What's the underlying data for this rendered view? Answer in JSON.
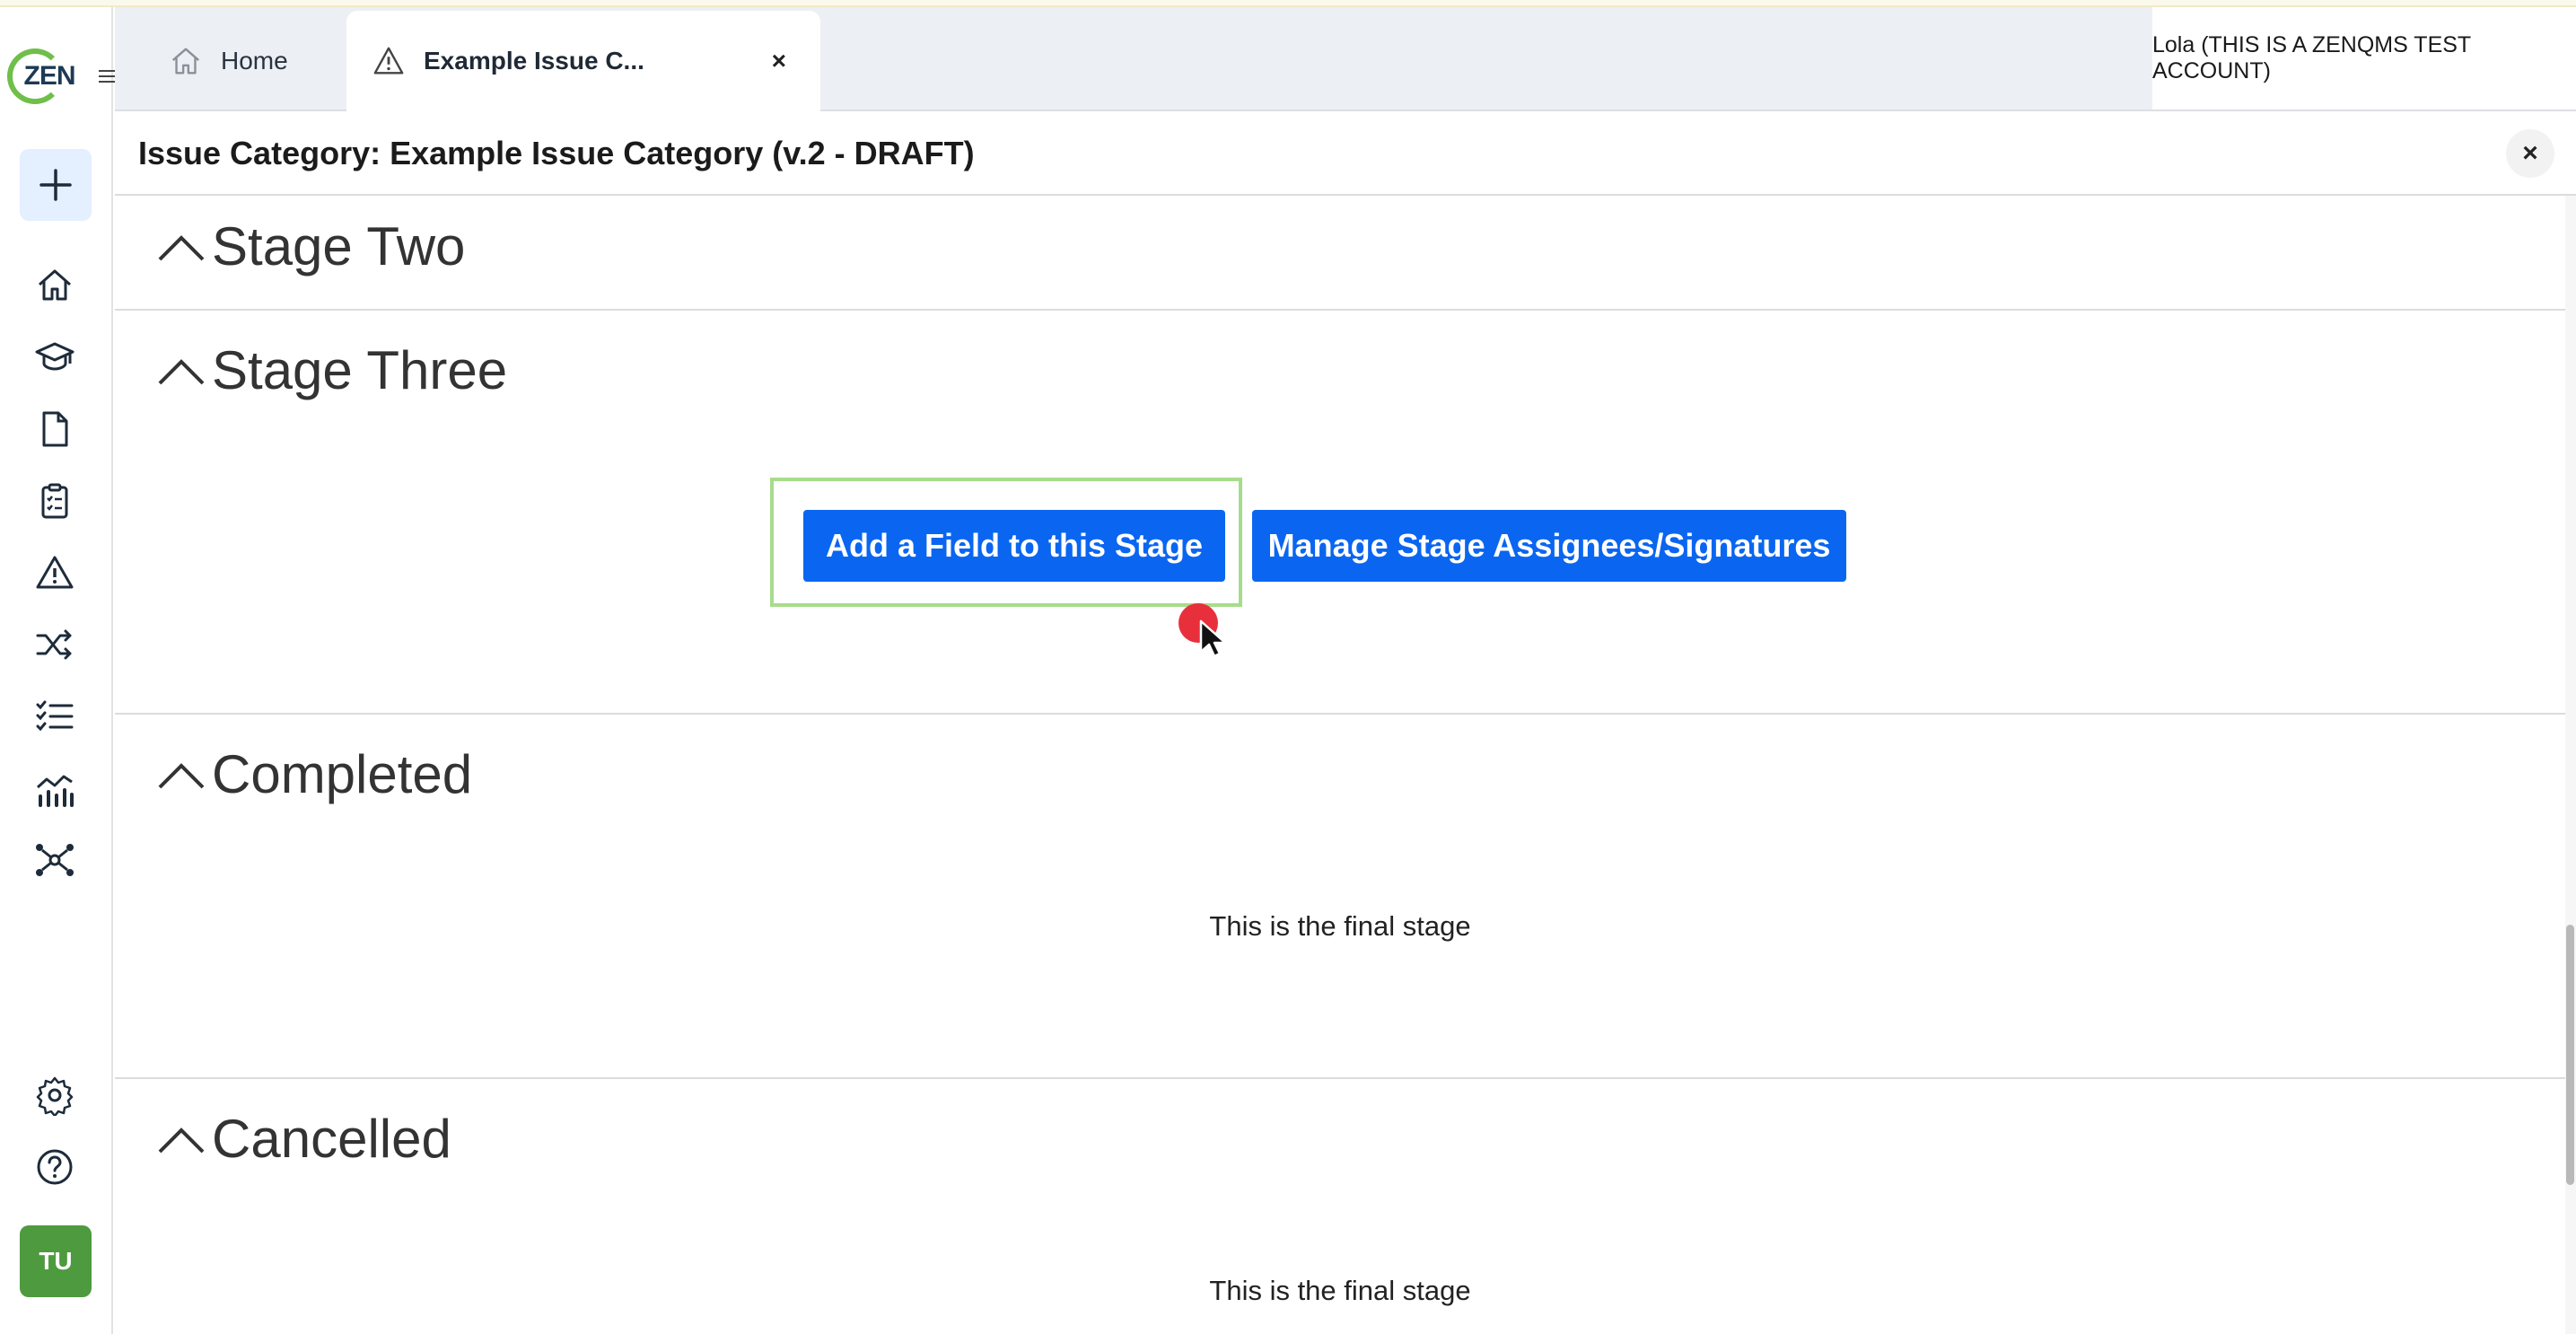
{
  "rail": {
    "logo_text": "ZEN",
    "avatar_initials": "TU"
  },
  "tabs": [
    {
      "label": "Home",
      "icon": "home-icon"
    },
    {
      "label": "Example Issue C...",
      "icon": "warning-icon",
      "close": "×"
    }
  ],
  "user": {
    "label": "Lola (THIS IS A ZENQMS TEST ACCOUNT)"
  },
  "panel": {
    "title": "Issue Category: Example Issue Category (v.2 - DRAFT)",
    "close": "×"
  },
  "stages": [
    {
      "title": "Stage Two"
    },
    {
      "title": "Stage Three",
      "buttons": [
        "Add a Field to this Stage",
        "Manage Stage Assignees/Signatures"
      ]
    },
    {
      "title": "Completed",
      "note": "This is the final stage"
    },
    {
      "title": "Cancelled",
      "note": "This is the final stage"
    }
  ],
  "colors": {
    "primary_button": "#0a66f0",
    "focus_outline": "#a7dc8c",
    "avatar": "#4e9a3f"
  }
}
